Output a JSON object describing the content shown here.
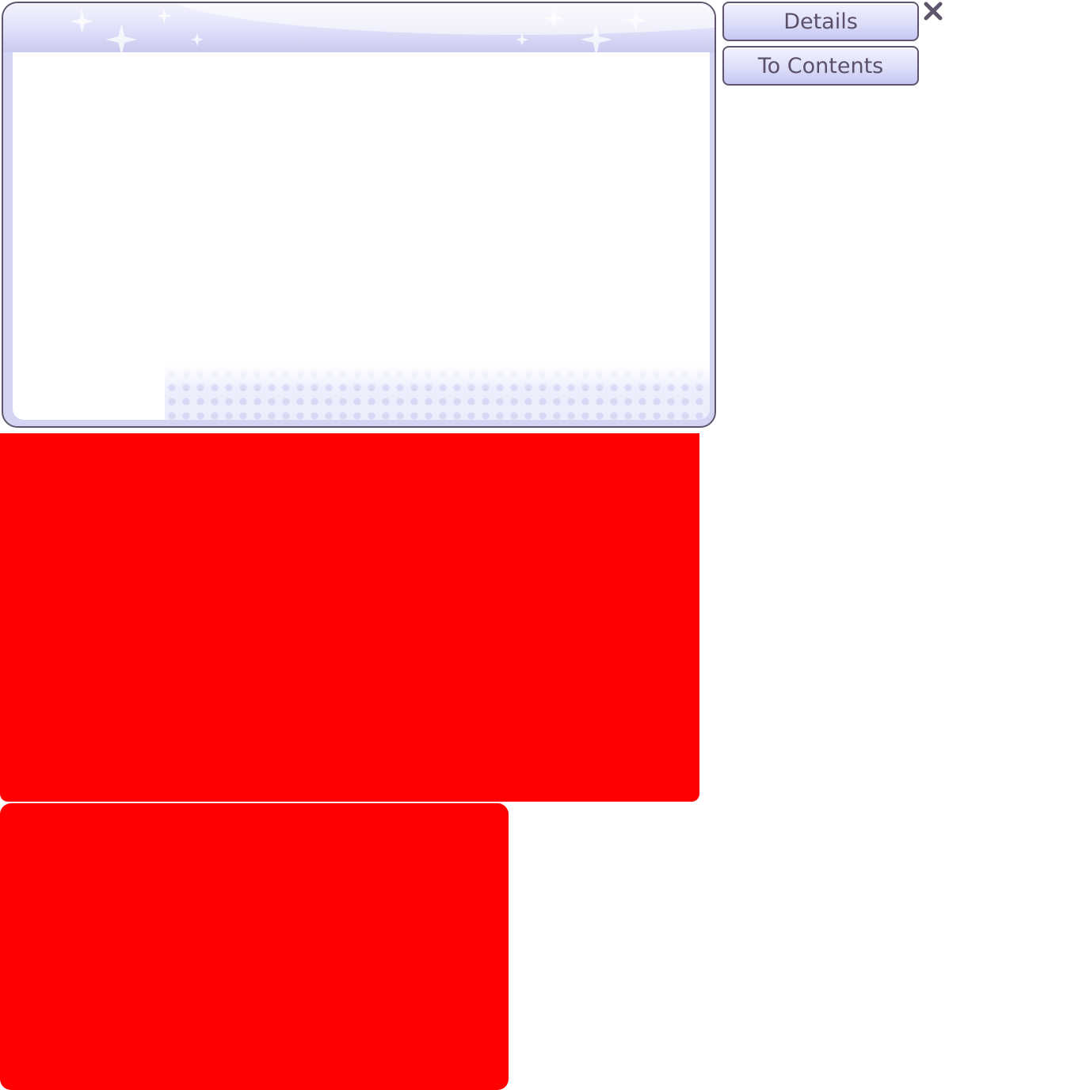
{
  "buttons": {
    "details_label": "Details",
    "to_contents_label": "To Contents"
  },
  "icons": {
    "close": "close-icon",
    "sparkle": "sparkle-icon"
  },
  "colors": {
    "frame_border": "#5f566e",
    "frame_tint": "#d4d5f3",
    "button_text": "#5a5168",
    "panel_red": "#ff0000"
  }
}
